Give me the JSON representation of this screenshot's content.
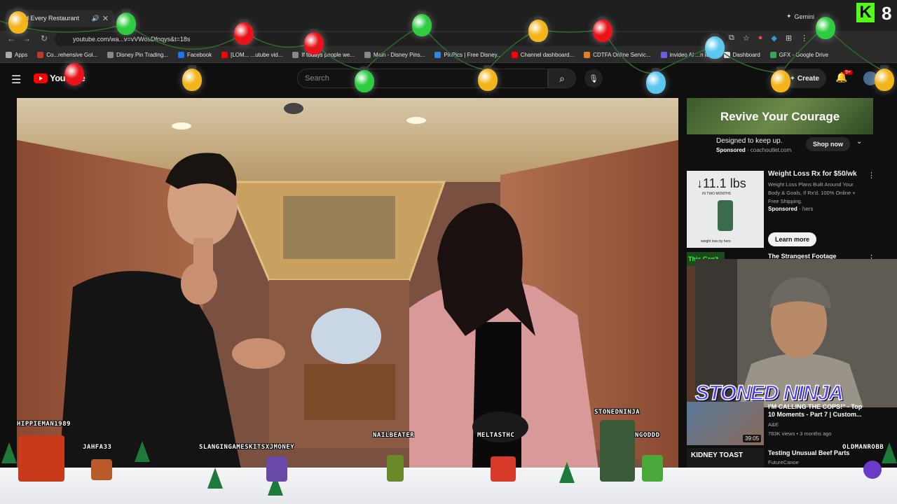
{
  "browser": {
    "tab_title": "I Tried Every Restaurant",
    "url": "youtube.com/wa...v=vVWosDfnqys&t=18s",
    "gemini_label": "Gemini",
    "overlay_badge": "8",
    "bookmarks": [
      {
        "label": "Apps",
        "color": "#aaaaaa"
      },
      {
        "label": "Co...rehensive Gol...",
        "color": "#c0392b"
      },
      {
        "label": "Disney Pin Trading...",
        "color": "#888888"
      },
      {
        "label": "Facebook",
        "color": "#1877f2"
      },
      {
        "label": "[LOM... ...utube vid...",
        "color": "#ff0000"
      },
      {
        "label": "If todays people we...",
        "color": "#888888"
      },
      {
        "label": "Main - Disney Pins...",
        "color": "#888888"
      },
      {
        "label": "PinPics | Free Disney...",
        "color": "#2e86de"
      },
      {
        "label": "Channel dashboard...",
        "color": "#ff0000"
      },
      {
        "label": "CDTFA Online Servic...",
        "color": "#e67e22"
      },
      {
        "label": "invideo AI ...n id...",
        "color": "#6c5ce7"
      },
      {
        "label": "Dashboard",
        "color": "#dddddd"
      },
      {
        "label": "GFX - Google Drive",
        "color": "#34a853"
      }
    ]
  },
  "youtube": {
    "logo_text": "YouTube",
    "search_placeholder": "Search",
    "create_label": "Create",
    "notification_count": "9+"
  },
  "sidebar": {
    "ad1": {
      "banner_text": "Revive Your Courage",
      "headline": "Designed to keep up.",
      "sponsored": "Sponsored",
      "advertiser": "coachoutlet.com",
      "cta": "Shop now"
    },
    "ad2": {
      "thumb_big": "↓11.1 lbs",
      "thumb_small": "IN TWO MONTHS",
      "thumb_foot": "weight loss by hers",
      "title": "Weight Loss Rx for $50/wk",
      "description": "Weight Loss Plans Built Around Your Body & Goals, If Rx'd. 100% Online + Free Shipping.",
      "sponsored": "Sponsored",
      "advertiser": "hers",
      "cta": "Learn more"
    },
    "rec1": {
      "title": "The Strangest Footage",
      "thumb_text": "This Can't Be Real"
    },
    "rec2": {
      "title": "I'M CALLING THE COPS!\" - Top 10 Moments - Part 7 | Custom...",
      "channel": "A&E",
      "meta": "783K views • 3 months ago",
      "duration": "39:05"
    },
    "rec3": {
      "title": "Testing Unusual Beef Parts",
      "channel": "FutureCanoe",
      "thumb_text": "KIDNEY TOAST"
    }
  },
  "overlay": {
    "streamer_banner": "STONED NINJA",
    "chatters": [
      "HIPPIEMAN1989",
      "JAHFA33",
      "SLANGINGAMESKITSXJMONEY",
      "NAILBEATER",
      "MELTASTHC",
      "STONEDNINJA",
      "NGODDD",
      "OLDMANROBB"
    ]
  }
}
